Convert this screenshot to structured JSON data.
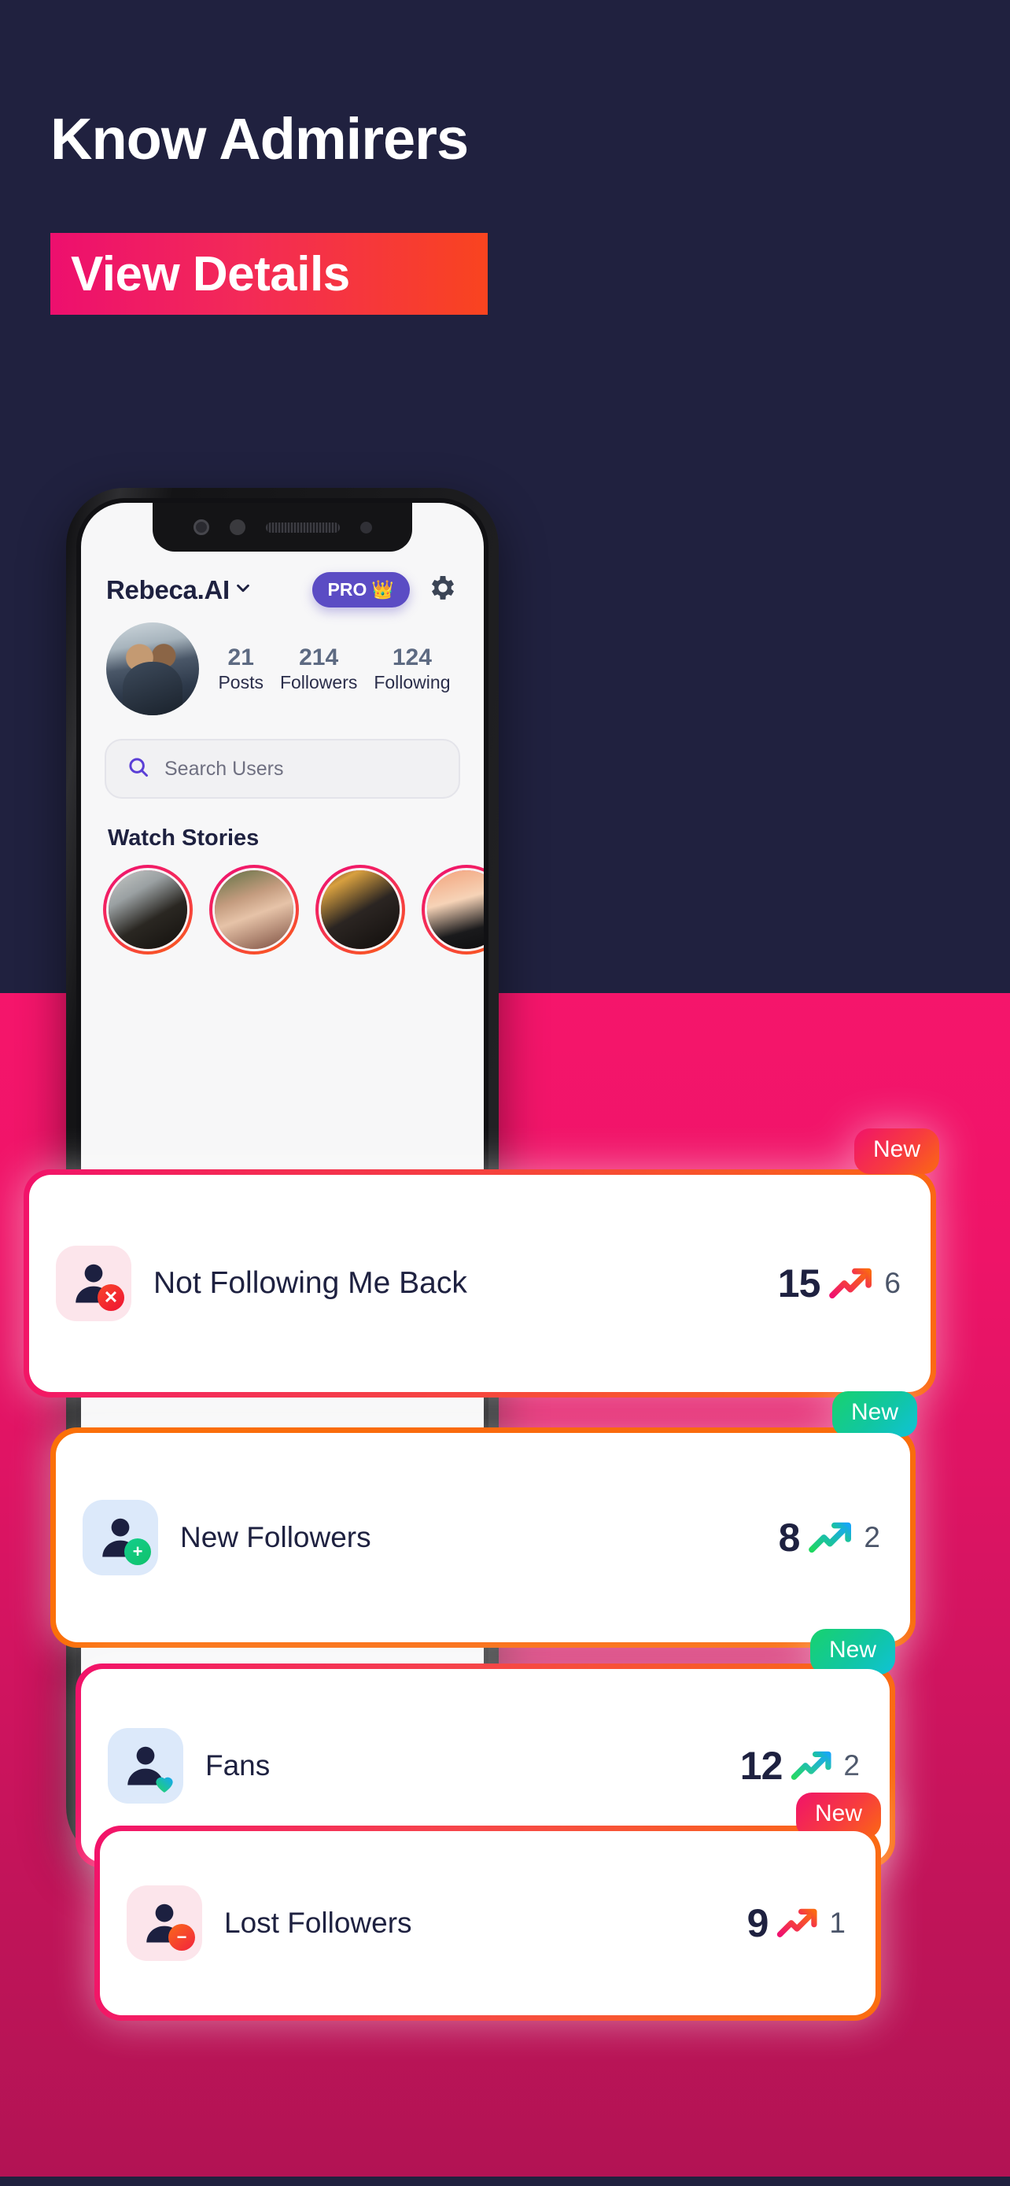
{
  "hero": {
    "headline": "Know Admirers",
    "banner_text": "View Details",
    "navy": "#20213f",
    "pink": "#F5156B",
    "gradient_start": "#ED0F6E",
    "gradient_end": "#F9441F"
  },
  "phone": {
    "header": {
      "profile_name": "Rebeca.AI",
      "chevron_icon": "chevron-down-icon",
      "pro_label": "PRO",
      "pro_emoji": "👑",
      "pro_color": "#5B4CC4",
      "settings_icon": "gear-icon"
    },
    "stats": [
      {
        "value": "21",
        "label": "Posts"
      },
      {
        "value": "214",
        "label": "Followers"
      },
      {
        "value": "124",
        "label": "Following"
      }
    ],
    "search": {
      "icon": "search-icon",
      "placeholder": "Search Users",
      "value": "",
      "icon_color": "#5B3FD6"
    },
    "stories": {
      "title": "Watch Stories",
      "items": [
        {
          "name": "story-1"
        },
        {
          "name": "story-2"
        },
        {
          "name": "story-3"
        },
        {
          "name": "story-4"
        }
      ]
    }
  },
  "cards": [
    {
      "label": "Not Following Me Back",
      "count": "15",
      "delta": "6",
      "badge": "New",
      "badge_style": "pink",
      "icon": "user-remove-icon",
      "icon_bg": "#FCE5EB",
      "arrow": "trend-up-icon",
      "arrow_color_from": "#F0126F",
      "arrow_color_to": "#FA6A11"
    },
    {
      "label": "New Followers",
      "count": "8",
      "delta": "2",
      "badge": "New",
      "badge_style": "green",
      "icon": "user-add-icon",
      "icon_bg": "#DCE9FA",
      "arrow": "trend-up-icon",
      "arrow_color_from": "#1ED760",
      "arrow_color_to": "#17A6F5"
    },
    {
      "label": "Fans",
      "count": "12",
      "delta": "2",
      "badge": "New",
      "badge_style": "green",
      "icon": "user-heart-icon",
      "icon_bg": "#DCE9FA",
      "arrow": "trend-up-icon",
      "arrow_color_from": "#1ED760",
      "arrow_color_to": "#17A6F5"
    },
    {
      "label": "Lost Followers",
      "count": "9",
      "delta": "1",
      "badge": "New",
      "badge_style": "pink",
      "icon": "user-minus-icon",
      "icon_bg": "#FCE5EB",
      "arrow": "trend-up-icon",
      "arrow_color_from": "#F0126F",
      "arrow_color_to": "#FA6A11"
    }
  ]
}
